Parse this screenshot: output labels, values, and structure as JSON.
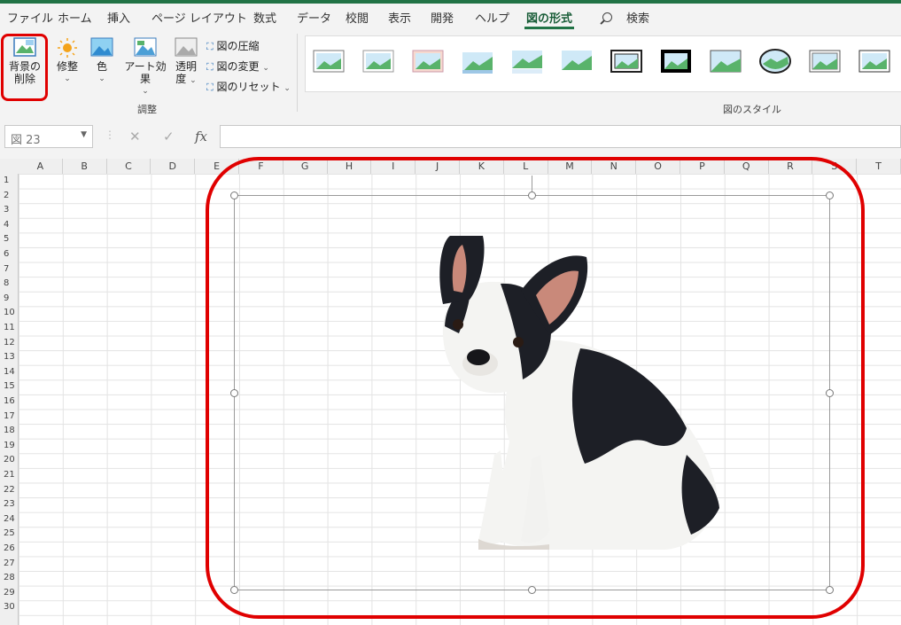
{
  "ribbon_tabs": [
    {
      "label": "ファイル"
    },
    {
      "label": "ホーム"
    },
    {
      "label": "挿入"
    },
    {
      "label": "ページ レイアウト"
    },
    {
      "label": "数式"
    },
    {
      "label": "データ"
    },
    {
      "label": "校閲"
    },
    {
      "label": "表示"
    },
    {
      "label": "開発"
    },
    {
      "label": "ヘルプ"
    },
    {
      "label": "図の形式"
    }
  ],
  "search": {
    "label": "検索"
  },
  "adjust_group": {
    "remove_background_line1": "背景の",
    "remove_background_line2": "削除",
    "corrections": "修整",
    "color": "色",
    "artistic_effects": "アート効果",
    "transparency_line1": "透明",
    "transparency_line2": "度",
    "compress": "図の圧縮",
    "change": "図の変更",
    "reset": "図のリセット",
    "group_label": "調整"
  },
  "styles_group": {
    "group_label": "図のスタイル"
  },
  "formula_bar": {
    "name_box": "図 23",
    "fx": "fx",
    "cancel": "✕",
    "enter": "✓",
    "value": ""
  },
  "columns": [
    "A",
    "B",
    "C",
    "D",
    "E",
    "F",
    "G",
    "H",
    "I",
    "J",
    "K",
    "L",
    "M",
    "N",
    "O",
    "P",
    "Q",
    "R",
    "S",
    "T"
  ],
  "rows": [
    "1",
    "2",
    "3",
    "4",
    "5",
    "6",
    "7",
    "8",
    "9",
    "10",
    "11",
    "12",
    "13",
    "14",
    "15",
    "16",
    "17",
    "18",
    "19",
    "20",
    "21",
    "22",
    "23",
    "24",
    "25",
    "26",
    "27",
    "28",
    "29",
    "30"
  ],
  "colors": {
    "accent": "#217346",
    "highlight": "#e00000"
  }
}
